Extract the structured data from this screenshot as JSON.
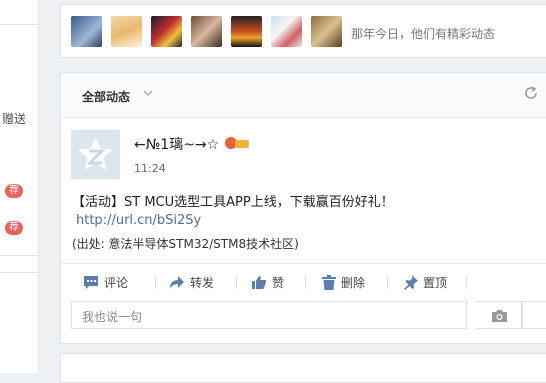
{
  "sidebar": {
    "gift_label": "赠送",
    "badges": [
      "荐",
      "荐"
    ]
  },
  "friends_bar": {
    "avatars": [
      "friend-1",
      "friend-2",
      "friend-3",
      "friend-4",
      "friend-5",
      "friend-6",
      "friend-7"
    ],
    "caption": "那年今日，他们有精彩动态"
  },
  "feed": {
    "filter_label": "全部动态",
    "post": {
      "author": "←№1璃~→☆",
      "time": "11:24",
      "text": "【活动】ST MCU选型工具APP上线，下载赢百份好礼！",
      "link": "http://url.cn/bSi2Sy",
      "source": "(出处: 意法半导体STM32/STM8技术社区)"
    },
    "actions": [
      {
        "label": "评论",
        "icon": "comment-icon"
      },
      {
        "label": "转发",
        "icon": "forward-icon"
      },
      {
        "label": "赞",
        "icon": "thumbs-up-icon"
      },
      {
        "label": "删除",
        "icon": "trash-icon"
      },
      {
        "label": "置顶",
        "icon": "pin-icon"
      }
    ],
    "comment_placeholder": "我也说一句"
  },
  "colors": {
    "accent": "#4a6ea0",
    "badge": "#e8625a",
    "background": "#eef1f4"
  }
}
